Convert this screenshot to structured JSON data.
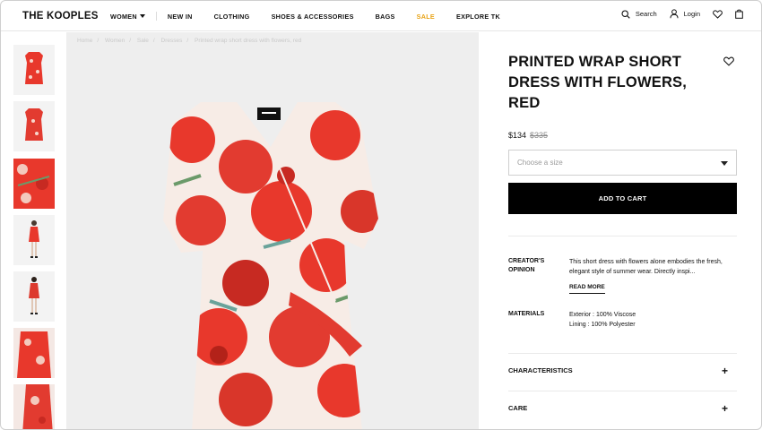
{
  "header": {
    "logo": "THE KOOPLES",
    "nav": [
      {
        "label": "WOMEN",
        "has_caret": true
      },
      {
        "label": "NEW IN"
      },
      {
        "label": "CLOTHING"
      },
      {
        "label": "SHOES & ACCESSORIES"
      },
      {
        "label": "BAGS"
      },
      {
        "label": "SALE",
        "color": "#e8a316"
      },
      {
        "label": "EXPLORE TK"
      }
    ],
    "search_label": "Search",
    "login_label": "Login"
  },
  "breadcrumb": [
    "Home",
    "Women",
    "Sale",
    "Dresses",
    "Printed wrap short dress with flowers, red"
  ],
  "thumbnails": [
    {
      "name": "thumb-front-packshot"
    },
    {
      "name": "thumb-back-packshot"
    },
    {
      "name": "thumb-detail"
    },
    {
      "name": "thumb-model-front"
    },
    {
      "name": "thumb-model-back"
    },
    {
      "name": "thumb-model-side"
    },
    {
      "name": "thumb-model-detail"
    }
  ],
  "product": {
    "title": "PRINTED WRAP SHORT DRESS WITH FLOWERS, RED",
    "price": "$134",
    "old_price": "$335",
    "size_placeholder": "Choose a size",
    "add_to_cart": "ADD TO CART",
    "creators_opinion_label": "CREATOR'S OPINION",
    "creators_opinion_text": "This short dress with flowers alone embodies the fresh, elegant style of summer wear. Directly inspi...",
    "read_more": "READ MORE",
    "materials_label": "MATERIALS",
    "materials_lines": [
      "Exterior : 100% Viscose",
      "Lining : 100% Polyester"
    ],
    "accordion": [
      {
        "label": "CHARACTERISTICS",
        "icon": "+"
      },
      {
        "label": "CARE",
        "icon": "+"
      }
    ]
  },
  "colors": {
    "accent_sale": "#e8a316",
    "dress_red": "#e8382c",
    "cart_bg": "#000000"
  }
}
